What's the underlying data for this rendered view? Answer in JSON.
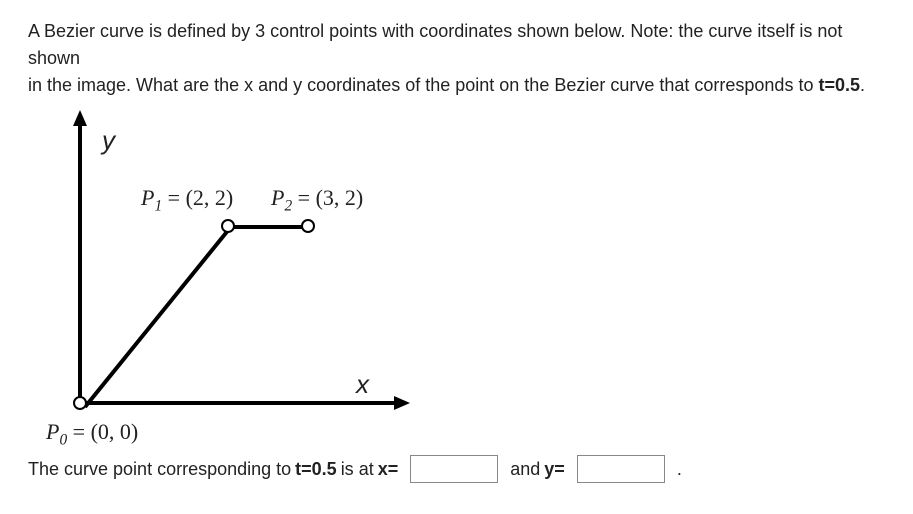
{
  "question_line1": "A Bezier curve is defined by 3 control points with coordinates shown below. Note: the curve itself is not shown",
  "question_line2_a": "in the image. What are the x and y coordinates of the point on the Bezier curve that corresponds to ",
  "question_line2_b": "t=0.5",
  "question_line2_c": ".",
  "diagram": {
    "y_label": "y",
    "x_label": "x",
    "p0_label": "P",
    "p0_sub": "0",
    "p0_coord": " = (0, 0)",
    "p1_label": "P",
    "p1_sub": "1",
    "p1_coord": " = (2, 2)",
    "p2_label": "P",
    "p2_sub": "2",
    "p2_coord": " = (3, 2)"
  },
  "answer": {
    "prefix": "The curve point corresponding to ",
    "t_bold": "t=0.5",
    "mid1": " is at ",
    "x_bold": "x=",
    "mid2": " and ",
    "y_bold": "y=",
    "suffix": ".",
    "x_value": "",
    "y_value": ""
  }
}
